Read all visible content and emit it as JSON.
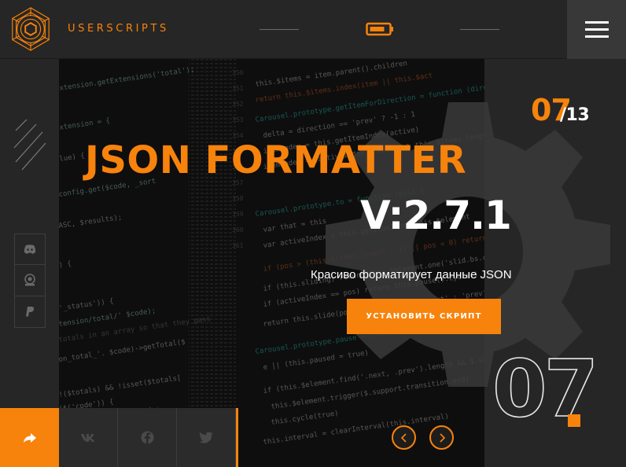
{
  "header": {
    "brand": "USERSCRIPTS",
    "logo_icon": "hexagon-mandala-logo-icon",
    "center_icon": "battery-icon",
    "menu_icon": "hamburger-menu-icon"
  },
  "slider": {
    "current": "07",
    "total": "/13",
    "big_number": "07",
    "title": "JSON FORMATTER",
    "version": "V:2.7.1",
    "subtitle": "Красиво форматирует данные JSON",
    "install_label": "УСТАНОВИТЬ СКРИПТ",
    "prev_icon": "chevron-left-icon",
    "next_icon": "chevron-right-icon"
  },
  "side_socials": [
    "discord-icon",
    "coin-icon",
    "paypal-icon"
  ],
  "share": {
    "main_icon": "share-arrow-icon",
    "networks": [
      "vk-icon",
      "facebook-icon",
      "twitter-icon"
    ]
  },
  "colors": {
    "accent": "#f7830c",
    "background": "#262626",
    "hero": "#131313"
  }
}
